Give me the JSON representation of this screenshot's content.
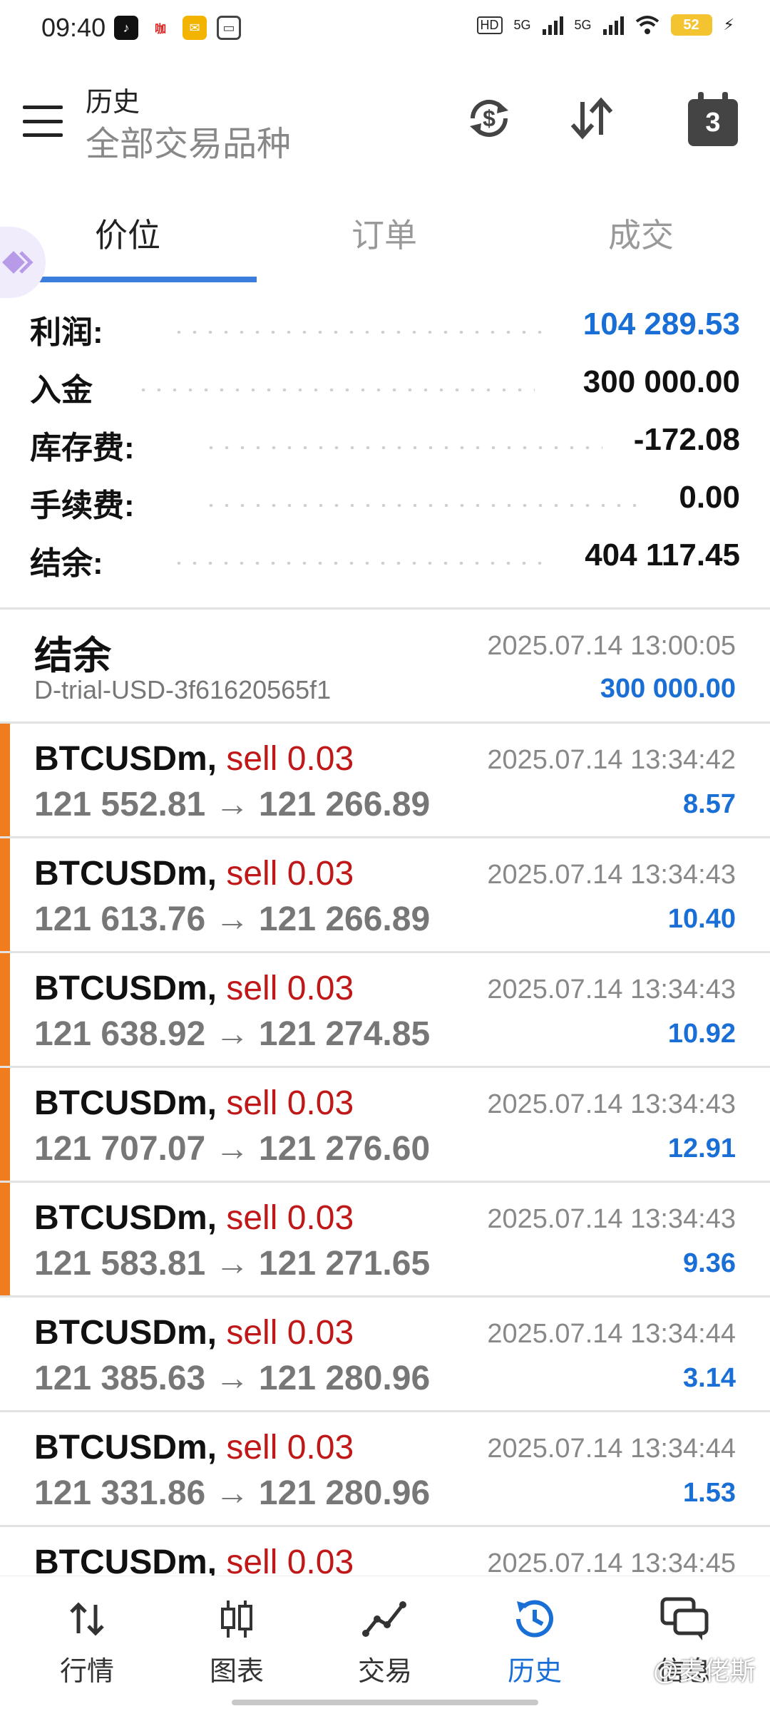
{
  "status_bar": {
    "time": "09:40",
    "battery": "52",
    "net1": "HD",
    "net2": "5G",
    "net3": "5G"
  },
  "header": {
    "title": "历史",
    "subtitle": "全部交易品种",
    "calendar_day": "3"
  },
  "tabs": [
    "价位",
    "订单",
    "成交"
  ],
  "summary": [
    {
      "label": "利润:",
      "value": "104 289.53",
      "highlight": true
    },
    {
      "label": "入金",
      "value": "300 000.00",
      "highlight": false
    },
    {
      "label": "库存费:",
      "value": "-172.08",
      "highlight": false
    },
    {
      "label": "手续费:",
      "value": "0.00",
      "highlight": false
    },
    {
      "label": "结余:",
      "value": "404 117.45",
      "highlight": false
    }
  ],
  "balance_entry": {
    "title": "结余",
    "account": "D-trial-USD-3f61620565f1",
    "datetime": "2025.07.14 13:00:05",
    "amount": "300 000.00"
  },
  "deals": [
    {
      "symbol": "BTCUSDm,",
      "type": "sell 0.03",
      "open": "121 552.81",
      "close": "121 266.89",
      "time": "2025.07.14 13:34:42",
      "profit": "8.57",
      "marked": true
    },
    {
      "symbol": "BTCUSDm,",
      "type": "sell 0.03",
      "open": "121 613.76",
      "close": "121 266.89",
      "time": "2025.07.14 13:34:43",
      "profit": "10.40",
      "marked": true
    },
    {
      "symbol": "BTCUSDm,",
      "type": "sell 0.03",
      "open": "121 638.92",
      "close": "121 274.85",
      "time": "2025.07.14 13:34:43",
      "profit": "10.92",
      "marked": true
    },
    {
      "symbol": "BTCUSDm,",
      "type": "sell 0.03",
      "open": "121 707.07",
      "close": "121 276.60",
      "time": "2025.07.14 13:34:43",
      "profit": "12.91",
      "marked": true
    },
    {
      "symbol": "BTCUSDm,",
      "type": "sell 0.03",
      "open": "121 583.81",
      "close": "121 271.65",
      "time": "2025.07.14 13:34:43",
      "profit": "9.36",
      "marked": true
    },
    {
      "symbol": "BTCUSDm,",
      "type": "sell 0.03",
      "open": "121 385.63",
      "close": "121 280.96",
      "time": "2025.07.14 13:34:44",
      "profit": "3.14",
      "marked": false
    },
    {
      "symbol": "BTCUSDm,",
      "type": "sell 0.03",
      "open": "121 331.86",
      "close": "121 280.96",
      "time": "2025.07.14 13:34:44",
      "profit": "1.53",
      "marked": false
    },
    {
      "symbol": "BTCUSDm,",
      "type": "sell 0.03",
      "open": "",
      "close": "",
      "time": "2025.07.14 13:34:45",
      "profit": "",
      "marked": false
    }
  ],
  "arrow": "→",
  "bottom_nav": [
    {
      "label": "行情",
      "icon": "quotes-arrows-icon",
      "active": false
    },
    {
      "label": "图表",
      "icon": "candlestick-chart-icon",
      "active": false
    },
    {
      "label": "交易",
      "icon": "trade-line-icon",
      "active": false
    },
    {
      "label": "历史",
      "icon": "history-clock-icon",
      "active": true
    },
    {
      "label": "信息",
      "icon": "messages-icon",
      "active": false
    }
  ],
  "watermark": "@麦佬斯",
  "colors": {
    "accent_blue": "#1a6fd6",
    "sell_red": "#c01818",
    "marker_orange": "#f07c1e"
  }
}
